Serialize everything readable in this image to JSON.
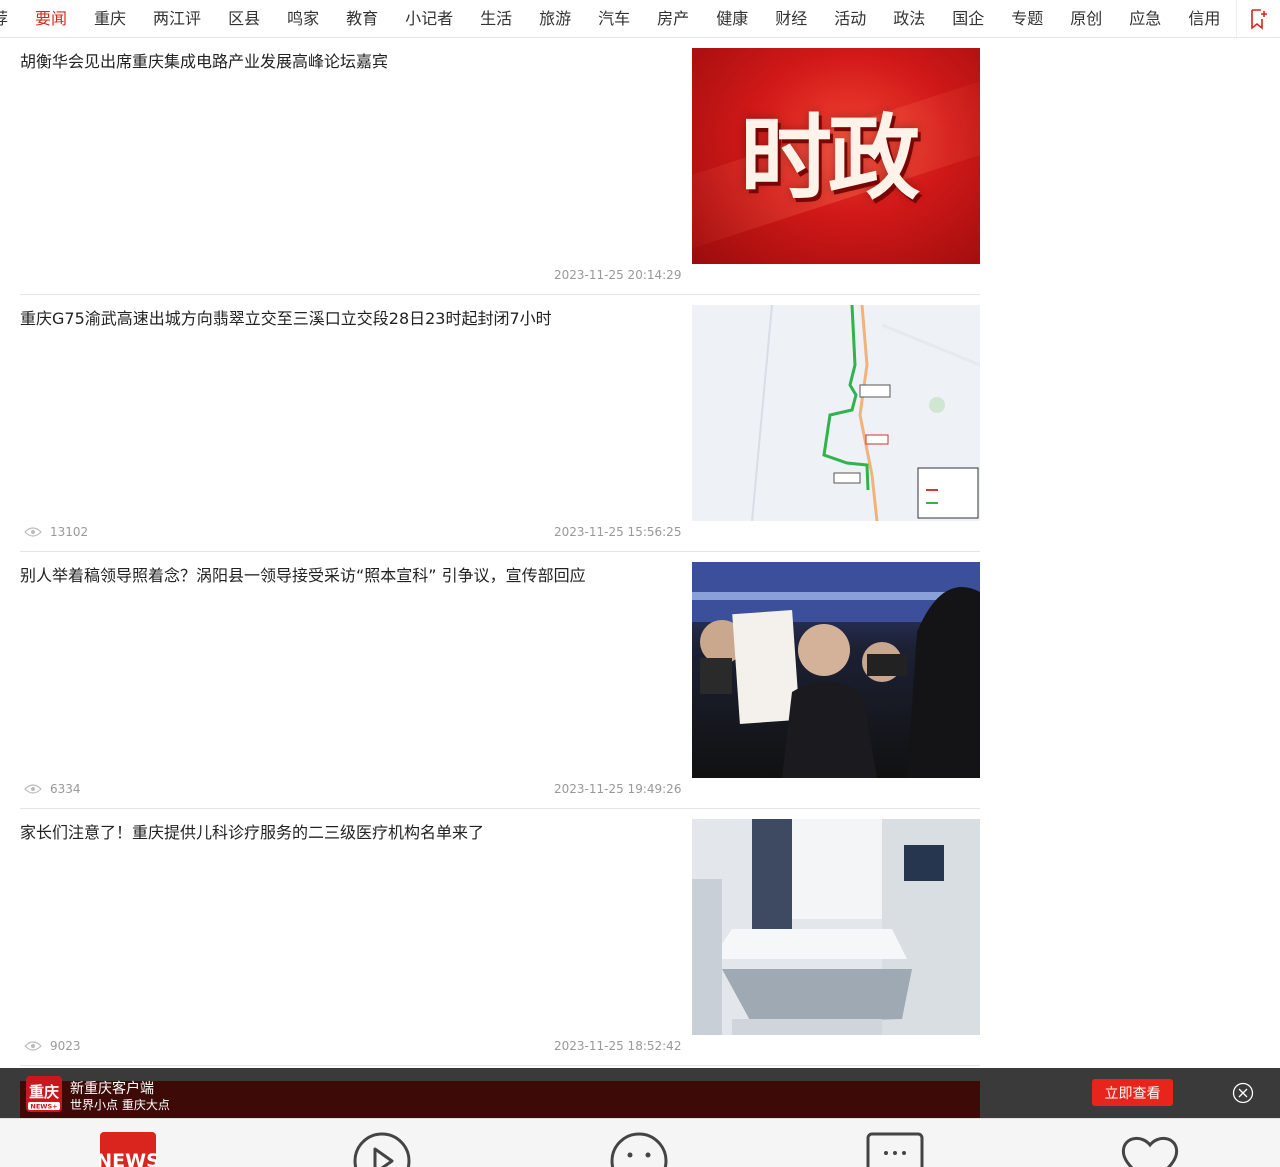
{
  "nav": {
    "items": [
      "荐",
      "要闻",
      "重庆",
      "两江评",
      "区县",
      "鸣家",
      "教育",
      "小记者",
      "生活",
      "旅游",
      "汽车",
      "房产",
      "健康",
      "财经",
      "活动",
      "政法",
      "国企",
      "专题",
      "原创",
      "应急",
      "信用"
    ],
    "active_index": 1,
    "accent": "#d9251d",
    "more_icon": "bookmark-plus-icon"
  },
  "articles": [
    {
      "title": "胡衡华会见出席重庆集成电路产业发展高峰论坛嘉宾",
      "views": "",
      "time": "2023-11-25 20:14:29",
      "thumb_text": "时政"
    },
    {
      "title": "重庆G75渝武高速出城方向翡翠立交至三溪口立交段28日23时起封闭7小时",
      "views": "13102",
      "time": "2023-11-25 15:56:25"
    },
    {
      "title": "别人举着稿领导照着念？涡阳县一领导接受采访“照本宣科” 引争议，宣传部回应",
      "views": "6334",
      "time": "2023-11-25 19:49:26"
    },
    {
      "title": "家长们注意了！重庆提供儿科诊疗服务的二三级医疗机构名单来了",
      "views": "9023",
      "time": "2023-11-25 18:52:42"
    }
  ],
  "banner": {
    "logo_text": "重庆",
    "logo_sub": "NEWS+",
    "title": "新重庆客户端",
    "subtitle": "世界小点  重庆大点",
    "open_label": "立即查看",
    "accent": "#e8251d"
  },
  "tabbar": {
    "news_label": "NEWS",
    "icons": [
      "news-icon",
      "play-icon",
      "smile-icon",
      "chat-icon",
      "heart-icon"
    ]
  }
}
